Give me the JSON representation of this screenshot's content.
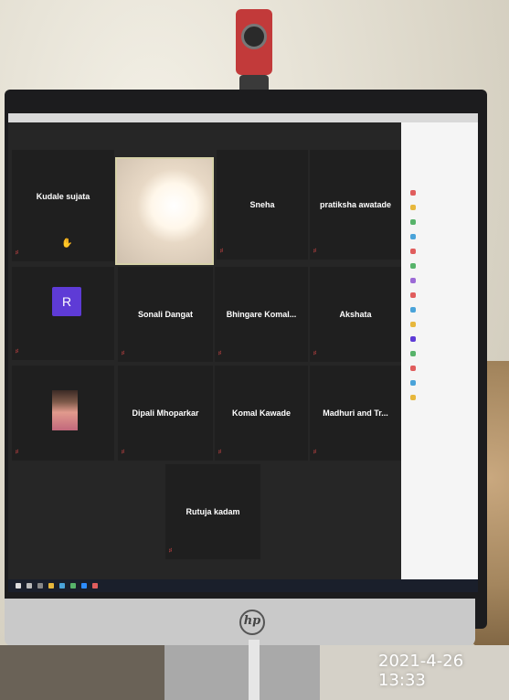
{
  "timestamp": "2021-4-26 13:33",
  "brand_logo": "hp",
  "meeting": {
    "participants": [
      {
        "name": "Kudale sujata",
        "has_hand_icon": true,
        "mic_muted": true
      },
      {
        "name": "Sneha",
        "mic_muted": true
      },
      {
        "name": "pratiksha awatade",
        "mic_muted": true
      },
      {
        "name": "Sonali Dangat",
        "mic_muted": true
      },
      {
        "name": "Bhingare Komal...",
        "mic_muted": true
      },
      {
        "name": "Akshata",
        "mic_muted": true
      },
      {
        "name": "Dipali Mhoparkar",
        "mic_muted": true
      },
      {
        "name": "Komal Kawade",
        "mic_muted": true
      },
      {
        "name": "Madhuri and Tr...",
        "mic_muted": true
      },
      {
        "name": "Rutuja kadam",
        "mic_muted": true
      }
    ],
    "avatar_letter": "R"
  },
  "colors": {
    "tile_bg": "#1f1f1f",
    "avatar_purple": "#5e3bd6",
    "mute_red": "#e54a4a",
    "panel_bg": "#f5f5f5"
  },
  "icons": [
    "webcam-icon",
    "hand-raise-icon",
    "mic-muted-icon",
    "windows-start-icon"
  ]
}
